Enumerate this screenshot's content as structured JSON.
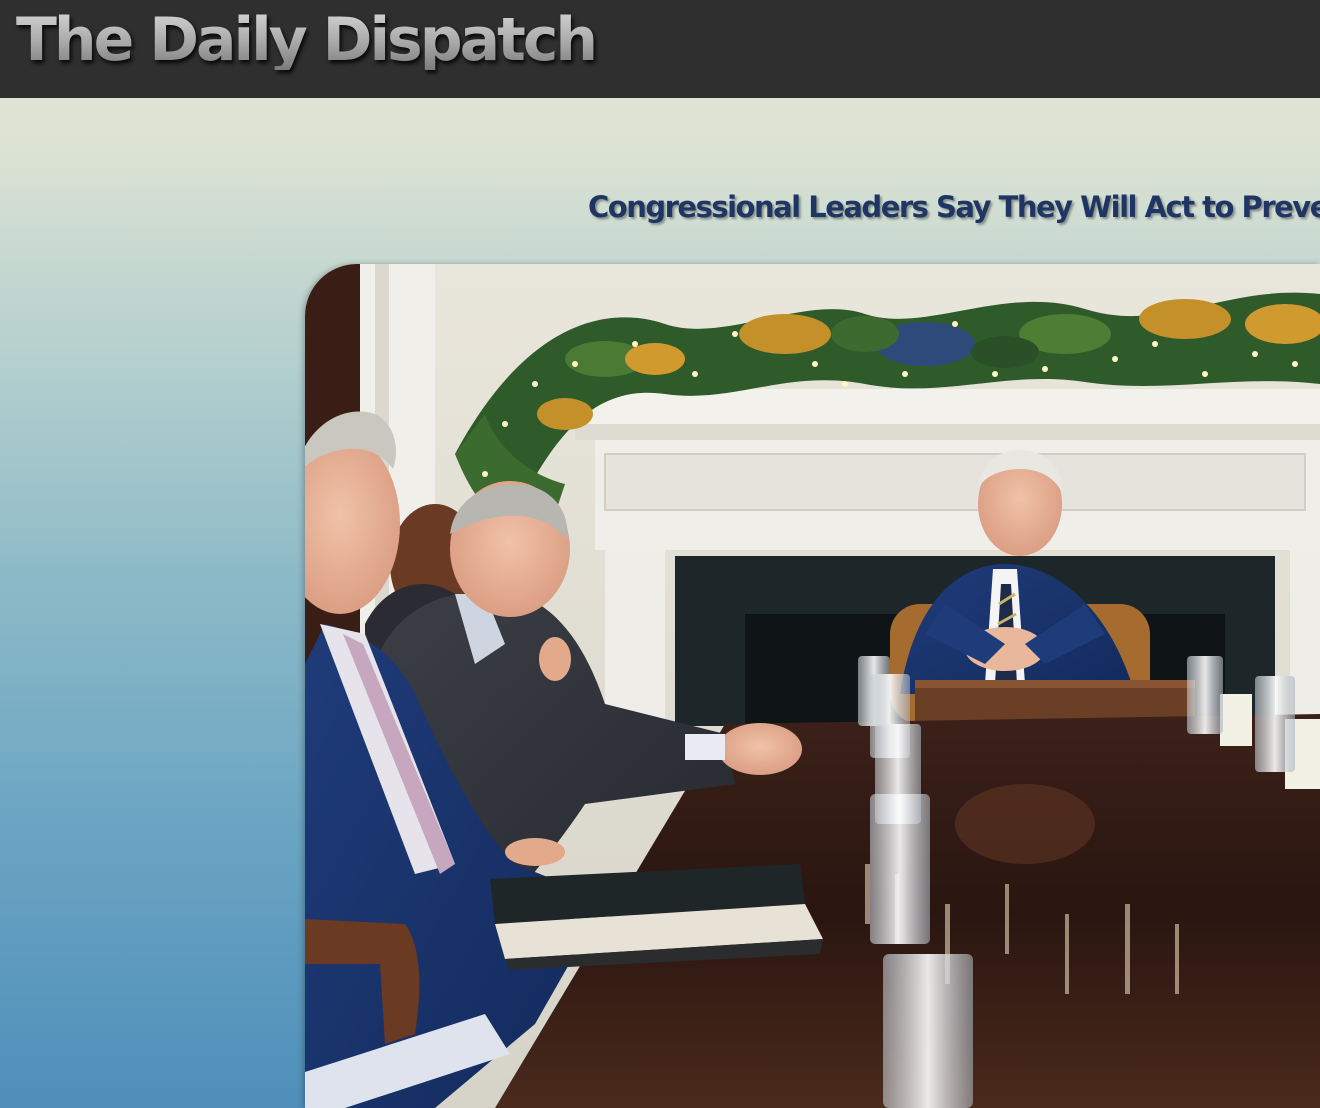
{
  "site": {
    "title": "The Daily Dispatch"
  },
  "article": {
    "headline": "Congressional Leaders Say They Will Act to Preve",
    "photo_alt": "Meeting at a long polished table in front of a decorated fireplace"
  },
  "colors": {
    "topbar": "#2f2f2f",
    "headline": "#1f3564",
    "background_top": "#e5e6d2",
    "background_bottom": "#4f8fba"
  }
}
